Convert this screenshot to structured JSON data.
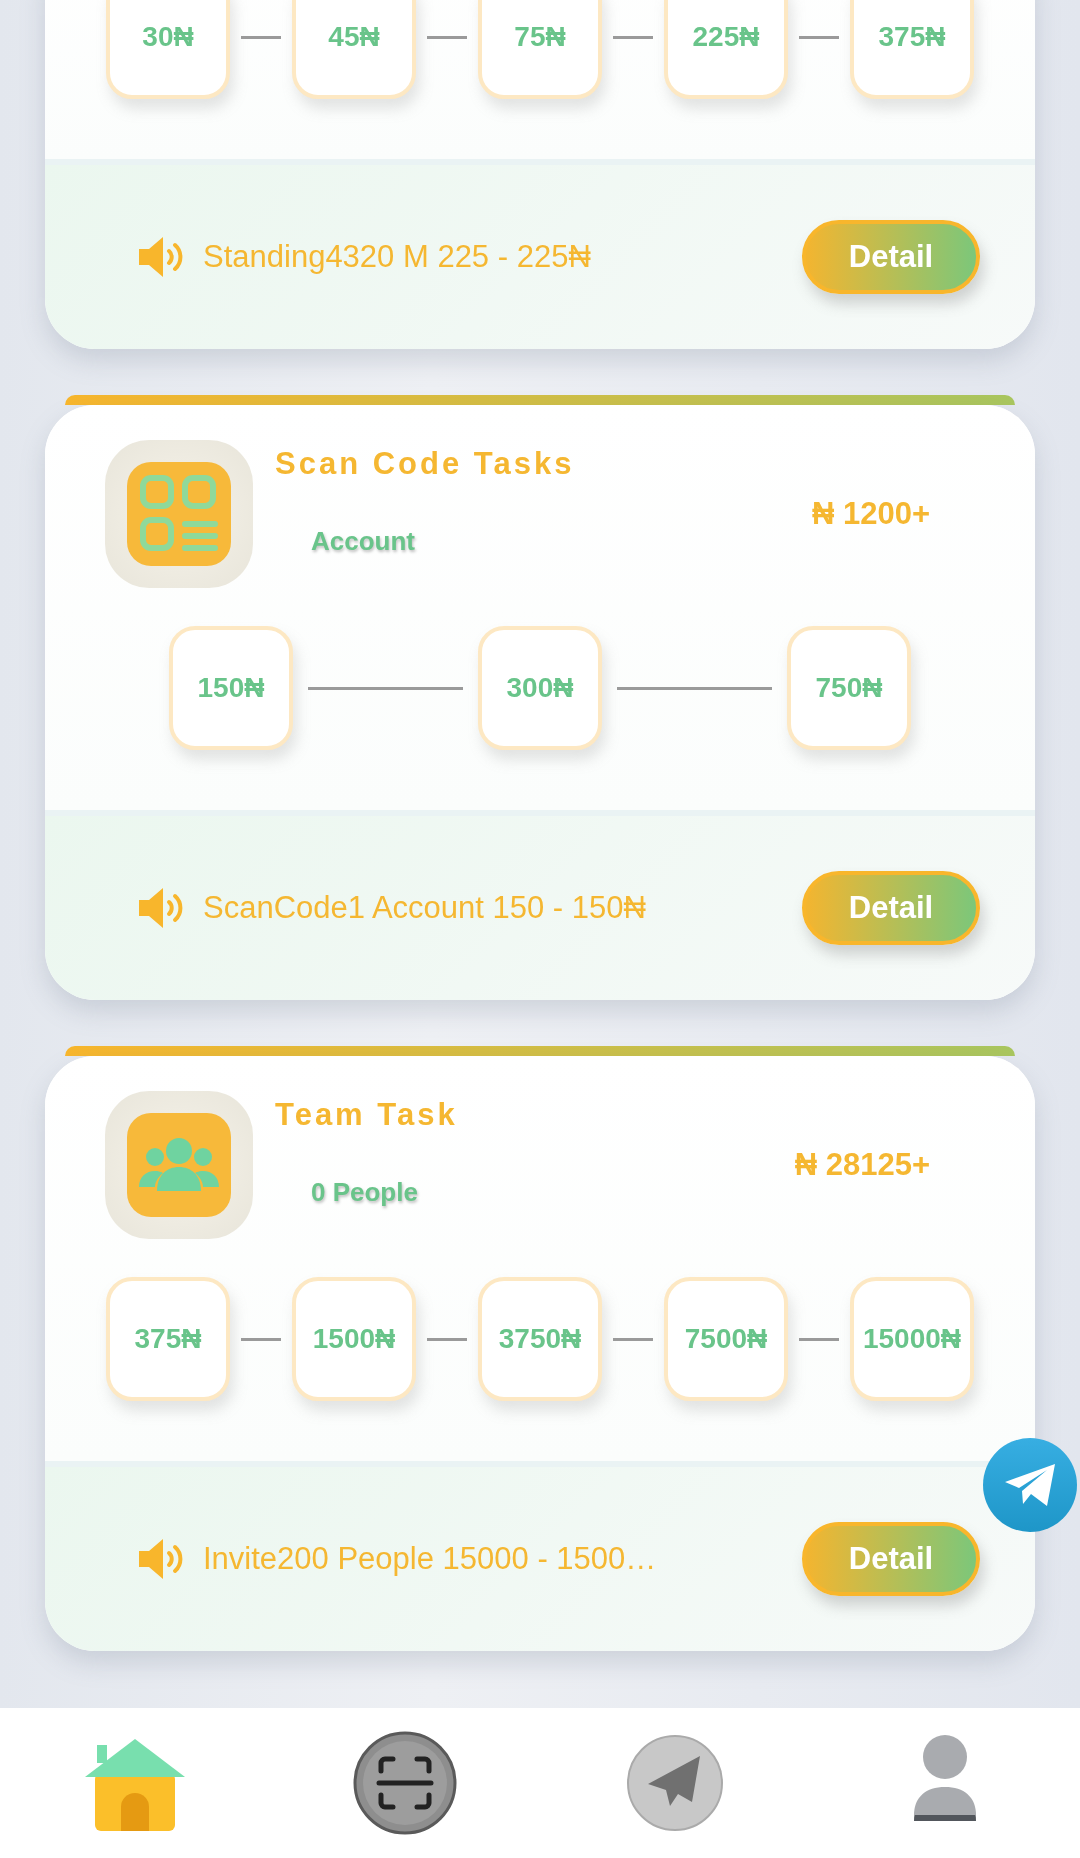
{
  "task_cards": [
    {
      "steps": [
        "30₦",
        "45₦",
        "75₦",
        "225₦",
        "375₦"
      ],
      "notice": "Standing4320 M 225 - 225₦",
      "button": "Detail"
    },
    {
      "kind": "qr",
      "title": "Scan Code Tasks",
      "subtitle": "Account",
      "reward": "₦ 1200+",
      "steps": [
        "150₦",
        "300₦",
        "750₦"
      ],
      "notice": "ScanCode1 Account 150 - 150₦",
      "button": "Detail"
    },
    {
      "kind": "team",
      "title": "Team Task",
      "subtitle": "0 People",
      "reward": "₦ 28125+",
      "steps": [
        "375₦",
        "1500₦",
        "3750₦",
        "7500₦",
        "15000₦"
      ],
      "notice": "Invite200 People 15000 - 1500…",
      "button": "Detail"
    }
  ],
  "bottom_nav": [
    {
      "kind": "home",
      "selected": true
    },
    {
      "kind": "scan",
      "selected": false
    },
    {
      "kind": "send",
      "selected": false
    },
    {
      "kind": "profile",
      "selected": false
    }
  ]
}
